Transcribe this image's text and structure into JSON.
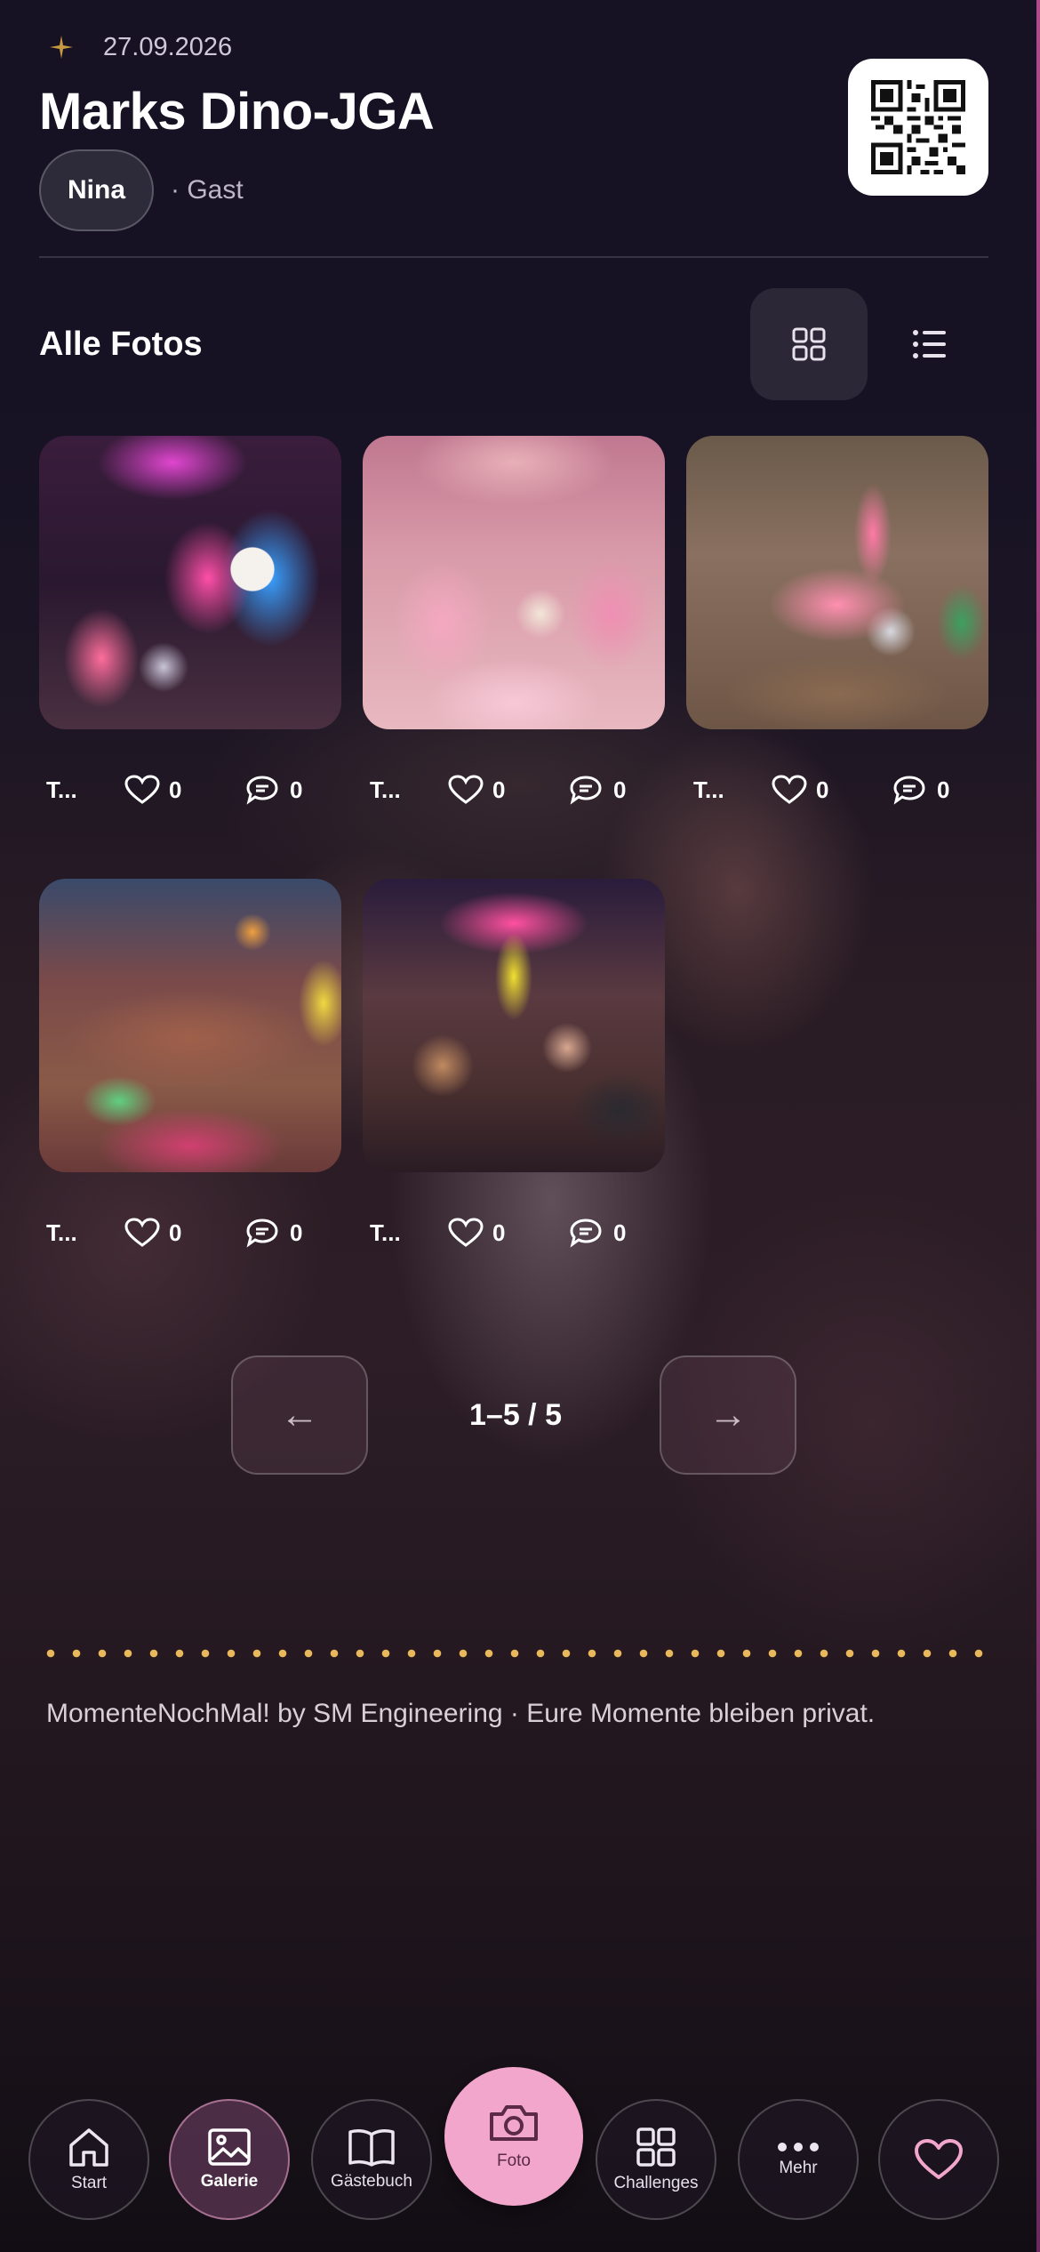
{
  "header": {
    "date": "27.09.2026",
    "title": "Marks Dino-JGA",
    "user_name": "Nina",
    "role": "· Gast"
  },
  "gallery": {
    "section_title": "Alle Fotos",
    "photos": [
      {
        "title": "T...",
        "likes": "0",
        "comments": "0"
      },
      {
        "title": "T...",
        "likes": "0",
        "comments": "0"
      },
      {
        "title": "T...",
        "likes": "0",
        "comments": "0"
      },
      {
        "title": "T...",
        "likes": "0",
        "comments": "0"
      },
      {
        "title": "T...",
        "likes": "0",
        "comments": "0"
      }
    ]
  },
  "pagination": {
    "prev": "←",
    "label": "1–5 / 5",
    "next": "→"
  },
  "footer": {
    "text": "MomenteNochMal! by SM Engineering · Eure Momente bleiben privat."
  },
  "nav": {
    "start": "Start",
    "galerie": "Galerie",
    "gaestebuch": "Gästebuch",
    "foto": "Foto",
    "challenges": "Challenges",
    "mehr": "Mehr"
  },
  "colors": {
    "accent_pink": "#f2a6cb",
    "dots_gold": "#e8b85a",
    "background": "#16101c"
  },
  "icons": {
    "date": "sparkle-icon",
    "qr": "qr-code-icon",
    "grid_view": "grid-view-icon",
    "list_view": "list-view-icon",
    "likes": "heart-outline-icon",
    "comments": "comment-icon",
    "start": "home-icon",
    "galerie": "image-icon",
    "gaestebuch": "book-icon",
    "foto": "camera-icon",
    "challenges": "grid-icon",
    "mehr": "more-dots-icon",
    "favorite": "heart-icon"
  }
}
